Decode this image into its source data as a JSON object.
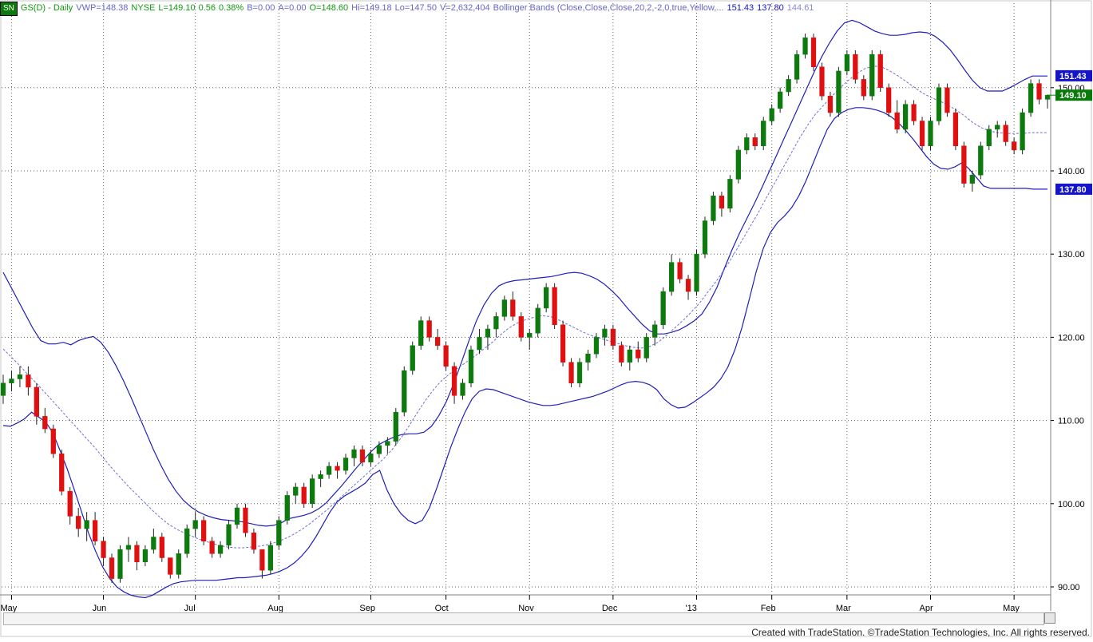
{
  "header": {
    "symbol_tag": "SN",
    "symbol": "GS(D) - Daily",
    "vwp": "VWP=148.38",
    "exchange": "NYSE",
    "last": "L=149.10",
    "change": "0.56",
    "change_pct": "0.38%",
    "bid": "B=0.00",
    "ask": "A=0.00",
    "open": "O=148.60",
    "high": "Hi=149.18",
    "low": "Lo=147.50",
    "volume": "V=2,632,404",
    "indicator": "Bollinger Bands (Close,Close,Close,20,2,-2,0,true,Yellow,...",
    "ind_upper": "151.43",
    "ind_lower": "137.80",
    "ind_mid": "144.61"
  },
  "footer": {
    "credit": "Created with TradeStation. ©TradeStation Technologies, Inc. All rights reserved."
  },
  "colors": {
    "up": "#0c7a0c",
    "down": "#e01010",
    "band": "#1f1fb8",
    "mid": "#6f6fd6",
    "grid": "#606060",
    "header_green": "#119911",
    "header_blue": "#6666cc",
    "label_blue": "#1414c8",
    "label_green": "#0a7a0a"
  },
  "chart_data": {
    "type": "candlestick",
    "title": "GS(D) - Daily",
    "ylim": [
      88,
      158
    ],
    "y_ticks": [
      90,
      100,
      110,
      120,
      130,
      140,
      150
    ],
    "y_tick_labels": [
      "90.00",
      "100.00",
      "110.00",
      "120.00",
      "130.00",
      "140.00",
      "150.00"
    ],
    "x_ticks": [
      "May",
      "Jun",
      "Jul",
      "Aug",
      "Sep",
      "Oct",
      "Nov",
      "Dec",
      "'13",
      "Feb",
      "Mar",
      "Apr",
      "May"
    ],
    "grid": true,
    "last_price_label": "149.10",
    "upper_band_label": "151.43",
    "lower_band_label": "137.80",
    "price_ohlc": [
      [
        113,
        115.5,
        112,
        114.5
      ],
      [
        114.5,
        116,
        113.5,
        115
      ],
      [
        115,
        116.5,
        114,
        115.5
      ],
      [
        115.5,
        116.5,
        113,
        114
      ],
      [
        114,
        114.5,
        109.5,
        110.5
      ],
      [
        110.5,
        111.5,
        108.5,
        109
      ],
      [
        109,
        109.5,
        105.5,
        106
      ],
      [
        106,
        106.5,
        101,
        101.5
      ],
      [
        101.5,
        102,
        97.5,
        98.5
      ],
      [
        98.5,
        99.5,
        96,
        97
      ],
      [
        97,
        99,
        95.5,
        98
      ],
      [
        98,
        99,
        95,
        95.5
      ],
      [
        95.5,
        96,
        92.5,
        93.5
      ],
      [
        93.5,
        94,
        90.5,
        91
      ],
      [
        91,
        95,
        90.5,
        94.5
      ],
      [
        94.5,
        96,
        93,
        95
      ],
      [
        95,
        95.5,
        92,
        93
      ],
      [
        93,
        95,
        92.5,
        94.5
      ],
      [
        94.5,
        97,
        94,
        96
      ],
      [
        96,
        96.5,
        93,
        93.5
      ],
      [
        93.5,
        93.5,
        91,
        91.5
      ],
      [
        91.5,
        94.5,
        91,
        94
      ],
      [
        94,
        97.5,
        93.5,
        97
      ],
      [
        97,
        99,
        96,
        98
      ],
      [
        98,
        98.5,
        95,
        95.5
      ],
      [
        95.5,
        96,
        93.5,
        94
      ],
      [
        94,
        95.5,
        93.5,
        95
      ],
      [
        95,
        98,
        94.5,
        97.5
      ],
      [
        97.5,
        100,
        97,
        99.5
      ],
      [
        99.5,
        100,
        96,
        96.5
      ],
      [
        96.5,
        97,
        94,
        94.5
      ],
      [
        94.5,
        94.5,
        91,
        92
      ],
      [
        92,
        95.5,
        91.5,
        95
      ],
      [
        95,
        98.5,
        94.5,
        98
      ],
      [
        98,
        101.5,
        97.5,
        101
      ],
      [
        101,
        102.5,
        100,
        102
      ],
      [
        102,
        102.5,
        99.5,
        100
      ],
      [
        100,
        103.5,
        99.5,
        103
      ],
      [
        103,
        104,
        102,
        103.5
      ],
      [
        103.5,
        105,
        103,
        104.5
      ],
      [
        104.5,
        105,
        103,
        104
      ],
      [
        104,
        106,
        103.5,
        105.5
      ],
      [
        105.5,
        107,
        104.5,
        106.5
      ],
      [
        106.5,
        107,
        104.5,
        105
      ],
      [
        105,
        106.5,
        104.5,
        106
      ],
      [
        106,
        107.5,
        105.5,
        107
      ],
      [
        107,
        108,
        106,
        107.5
      ],
      [
        107.5,
        111.5,
        107,
        111
      ],
      [
        111,
        116.5,
        110.5,
        116
      ],
      [
        116,
        119.5,
        115.5,
        119
      ],
      [
        119,
        122.5,
        118.5,
        122
      ],
      [
        122,
        122.5,
        119.5,
        120
      ],
      [
        120,
        121,
        118.5,
        119
      ],
      [
        119,
        119.5,
        116,
        116.5
      ],
      [
        116.5,
        117,
        112,
        113
      ],
      [
        113,
        115,
        112.5,
        114.5
      ],
      [
        114.5,
        119,
        114,
        118.5
      ],
      [
        118.5,
        121,
        118,
        120
      ],
      [
        120,
        121.5,
        118.5,
        121
      ],
      [
        121,
        123,
        120,
        122.5
      ],
      [
        122.5,
        125,
        122,
        124.5
      ],
      [
        124.5,
        125.5,
        122,
        122.5
      ],
      [
        122.5,
        123,
        119.5,
        120
      ],
      [
        120,
        121,
        118.5,
        120.5
      ],
      [
        120.5,
        124,
        120,
        123.5
      ],
      [
        123.5,
        126.5,
        123,
        126
      ],
      [
        126,
        126.5,
        121,
        121.5
      ],
      [
        121.5,
        122,
        116.5,
        117
      ],
      [
        117,
        117.5,
        114,
        114.5
      ],
      [
        114.5,
        117.5,
        114,
        117
      ],
      [
        117,
        118.5,
        116,
        118
      ],
      [
        118,
        120.5,
        117.5,
        120
      ],
      [
        120,
        121.5,
        119,
        121
      ],
      [
        121,
        121.5,
        118.5,
        119
      ],
      [
        119,
        119.5,
        116.5,
        117
      ],
      [
        117,
        119,
        116,
        118.5
      ],
      [
        118.5,
        119.5,
        117,
        117.5
      ],
      [
        117.5,
        120.5,
        117,
        120
      ],
      [
        120,
        122,
        119,
        121.5
      ],
      [
        121.5,
        126,
        121,
        125.5
      ],
      [
        125.5,
        130,
        125,
        129
      ],
      [
        129,
        129.5,
        126.5,
        127
      ],
      [
        127,
        127.5,
        124.5,
        125.5
      ],
      [
        125.5,
        130.5,
        125,
        130
      ],
      [
        130,
        134.5,
        129.5,
        134
      ],
      [
        134,
        137.5,
        133.5,
        137
      ],
      [
        137,
        137.5,
        134.5,
        135.5
      ],
      [
        135.5,
        139.5,
        135,
        139
      ],
      [
        139,
        143,
        138.5,
        142.5
      ],
      [
        142.5,
        144.5,
        142,
        144
      ],
      [
        144,
        144.5,
        142.5,
        143
      ],
      [
        143,
        146.5,
        142.5,
        146
      ],
      [
        146,
        148,
        145.5,
        147.5
      ],
      [
        147.5,
        150,
        147,
        149.5
      ],
      [
        149.5,
        151.5,
        149,
        151
      ],
      [
        151,
        154.5,
        150.5,
        154
      ],
      [
        154,
        156.5,
        153.5,
        156
      ],
      [
        156,
        156.5,
        152,
        152.5
      ],
      [
        152.5,
        153,
        148.5,
        149
      ],
      [
        149,
        149.5,
        146.5,
        147
      ],
      [
        147,
        152.5,
        146.5,
        152
      ],
      [
        152,
        154.5,
        151.5,
        154
      ],
      [
        154,
        154.5,
        150.5,
        151
      ],
      [
        151,
        151.5,
        148.5,
        149
      ],
      [
        149,
        154.5,
        148.5,
        154
      ],
      [
        154,
        154.5,
        149.5,
        150
      ],
      [
        150,
        150.5,
        146.5,
        147
      ],
      [
        147,
        148.5,
        144.5,
        145
      ],
      [
        145,
        148.5,
        144.5,
        148
      ],
      [
        148,
        148.5,
        145.5,
        146
      ],
      [
        146,
        146.5,
        142.5,
        143
      ],
      [
        143,
        146.5,
        142.5,
        146
      ],
      [
        146,
        150.5,
        145.5,
        150
      ],
      [
        150,
        150.5,
        146.5,
        147
      ],
      [
        147,
        147.5,
        142.5,
        143
      ],
      [
        143,
        143.5,
        138,
        138.5
      ],
      [
        138.5,
        140,
        137.5,
        139.5
      ],
      [
        139.5,
        143.5,
        139,
        143
      ],
      [
        143,
        145.5,
        142.5,
        145
      ],
      [
        145,
        146,
        144,
        145.5
      ],
      [
        145.5,
        146,
        143,
        143.5
      ],
      [
        143.5,
        144,
        142,
        142.5
      ],
      [
        142.5,
        147.5,
        142,
        147
      ],
      [
        147,
        151,
        146.5,
        150.5
      ],
      [
        150.5,
        151,
        148,
        148.6
      ],
      [
        148.6,
        149.18,
        147.5,
        149.1
      ]
    ],
    "bands": {
      "mid": [
        118.6,
        117.6,
        116.6,
        115.5,
        114.5,
        113.4,
        112.3,
        111.2,
        110.1,
        109.0,
        107.9,
        106.8,
        105.6,
        104.4,
        103.3,
        102.2,
        101.2,
        100.2,
        99.2,
        98.3,
        97.5,
        96.9,
        96.4,
        96.0,
        95.6,
        95.3,
        95.0,
        94.8,
        94.7,
        94.7,
        94.8,
        94.9,
        95.1,
        95.4,
        95.8,
        96.3,
        96.9,
        97.6,
        98.4,
        99.2,
        100.1,
        101.0,
        101.9,
        102.8,
        103.7,
        104.6,
        105.5,
        106.6,
        107.9,
        109.4,
        111.0,
        112.5,
        113.8,
        114.9,
        115.7,
        116.4,
        117.1,
        117.8,
        118.6,
        119.4,
        120.3,
        121.1,
        121.7,
        122.1,
        122.4,
        122.6,
        122.5,
        122.1,
        121.6,
        121.1,
        120.6,
        120.2,
        119.9,
        119.6,
        119.3,
        119.0,
        118.8,
        118.7,
        118.9,
        119.4,
        120.2,
        121.1,
        122.0,
        123.0,
        124.1,
        125.4,
        126.7,
        128.1,
        129.7,
        131.4,
        133.1,
        134.8,
        136.6,
        138.4,
        140.2,
        142.0,
        143.8,
        145.4,
        146.8,
        147.9,
        149.0,
        150.0,
        150.9,
        151.7,
        152.3,
        152.6,
        152.5,
        152.0,
        151.4,
        150.7,
        150.0,
        149.3,
        148.8,
        148.4,
        147.9,
        147.3,
        146.6,
        145.8,
        145.2,
        144.8,
        144.6,
        144.5,
        144.5,
        144.5,
        144.6,
        144.6,
        144.6
      ],
      "upper": [
        127.8,
        126.1,
        124.4,
        122.7,
        121.0,
        119.6,
        119.2,
        119.2,
        119.4,
        119.1,
        119.6,
        119.9,
        120.1,
        119.4,
        118.2,
        116.6,
        114.8,
        112.8,
        110.7,
        108.6,
        106.5,
        104.6,
        102.9,
        101.5,
        100.4,
        99.6,
        99.0,
        98.6,
        98.3,
        98.1,
        98.0,
        97.9,
        97.8,
        97.6,
        97.4,
        97.3,
        97.4,
        97.7,
        98.2,
        98.4,
        98.6,
        98.9,
        99.4,
        100.1,
        101.1,
        102.1,
        103.2,
        104.3,
        105.3,
        106.3,
        107.1,
        107.6,
        108.0,
        108.3,
        108.4,
        108.4,
        108.6,
        109.3,
        110.6,
        112.3,
        114.5,
        117.0,
        119.6,
        122.0,
        123.9,
        125.3,
        126.2,
        126.6,
        126.8,
        126.9,
        127.0,
        127.1,
        127.2,
        127.3,
        127.5,
        127.7,
        127.8,
        127.7,
        127.4,
        127.0,
        126.4,
        125.6,
        124.7,
        123.6,
        122.6,
        121.6,
        120.8,
        120.4,
        120.4,
        120.6,
        120.9,
        121.4,
        122.0,
        122.8,
        124.2,
        126.0,
        128.3,
        130.5,
        132.5,
        134.3,
        136.1,
        138.0,
        140.0,
        142.0,
        144.0,
        146.0,
        148.0,
        150.0,
        152.0,
        153.8,
        155.4,
        156.8,
        157.8,
        158.1,
        157.8,
        157.3,
        156.8,
        156.5,
        156.3,
        156.3,
        156.4,
        156.6,
        156.7,
        156.6,
        156.2,
        155.5,
        154.6,
        153.4,
        152.1,
        150.9,
        150.0,
        149.6,
        149.6,
        149.6,
        150.0,
        150.5,
        151.0,
        151.4,
        151.4,
        151.4
      ],
      "lower": [
        109.4,
        109.3,
        109.7,
        110.2,
        111.0,
        110.4,
        109.8,
        108.5,
        106.4,
        104.2,
        101.7,
        99.1,
        96.5,
        94.3,
        92.4,
        91.0,
        90.0,
        89.4,
        89.0,
        88.8,
        88.7,
        89.0,
        89.5,
        90.0,
        90.4,
        90.6,
        90.7,
        90.8,
        90.8,
        90.8,
        90.8,
        90.9,
        91.0,
        91.1,
        91.1,
        91.2,
        91.3,
        91.4,
        91.6,
        91.9,
        92.3,
        92.9,
        93.7,
        94.7,
        96.0,
        97.5,
        99.0,
        100.2,
        100.9,
        101.4,
        101.9,
        102.5,
        103.5,
        104.0,
        101.7,
        100.0,
        98.8,
        98.0,
        97.6,
        98.0,
        99.5,
        101.8,
        104.3,
        106.8,
        109.0,
        111.0,
        112.6,
        113.5,
        113.8,
        113.7,
        113.4,
        113.1,
        112.8,
        112.5,
        112.2,
        112.0,
        111.8,
        111.8,
        111.9,
        112.1,
        112.3,
        112.5,
        112.7,
        112.9,
        113.2,
        113.5,
        113.9,
        114.3,
        114.6,
        114.7,
        114.6,
        114.3,
        113.7,
        112.6,
        111.9,
        111.5,
        111.6,
        112.1,
        112.7,
        113.3,
        114.0,
        115.0,
        116.4,
        118.5,
        121.2,
        124.5,
        127.9,
        130.7,
        132.6,
        133.8,
        134.6,
        135.6,
        137.0,
        138.8,
        140.9,
        143.0,
        145.0,
        146.3,
        147.0,
        147.4,
        147.6,
        147.6,
        147.5,
        147.3,
        147.0,
        146.5,
        145.8,
        144.9,
        143.9,
        142.8,
        141.7,
        140.8,
        140.3,
        140.2,
        140.5,
        141.0,
        140.2,
        139.2,
        138.2,
        137.9,
        137.9,
        137.9,
        137.9,
        137.9,
        137.9,
        137.8,
        137.8,
        137.8
      ]
    }
  }
}
